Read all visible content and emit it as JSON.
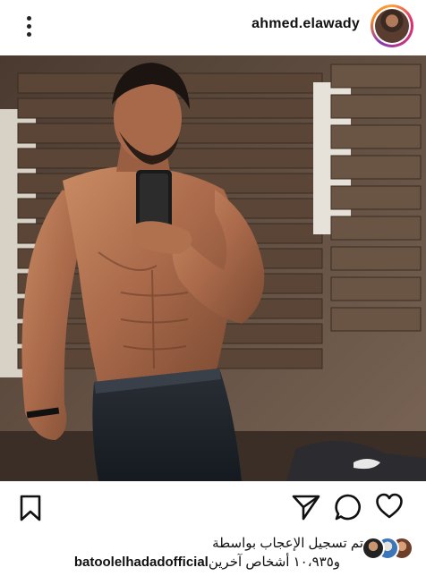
{
  "header": {
    "username": "ahmed.elawady",
    "more_icon": "more-vertical-icon",
    "avatar_icon": "profile-avatar"
  },
  "post": {
    "image_description_icon": "post-photo"
  },
  "actions": {
    "like_icon": "heart-icon",
    "comment_icon": "comment-icon",
    "share_icon": "paper-plane-icon",
    "save_icon": "bookmark-icon"
  },
  "likes": {
    "line1": "تم تسجيل الإعجاب بواسطة",
    "user": "batoolelhadadofficial",
    "others": "و١٠،٩٣٥ أشخاص آخرين"
  },
  "colors": {
    "text": "#111111",
    "background": "#ffffff",
    "story_ring": "#e1306c"
  }
}
